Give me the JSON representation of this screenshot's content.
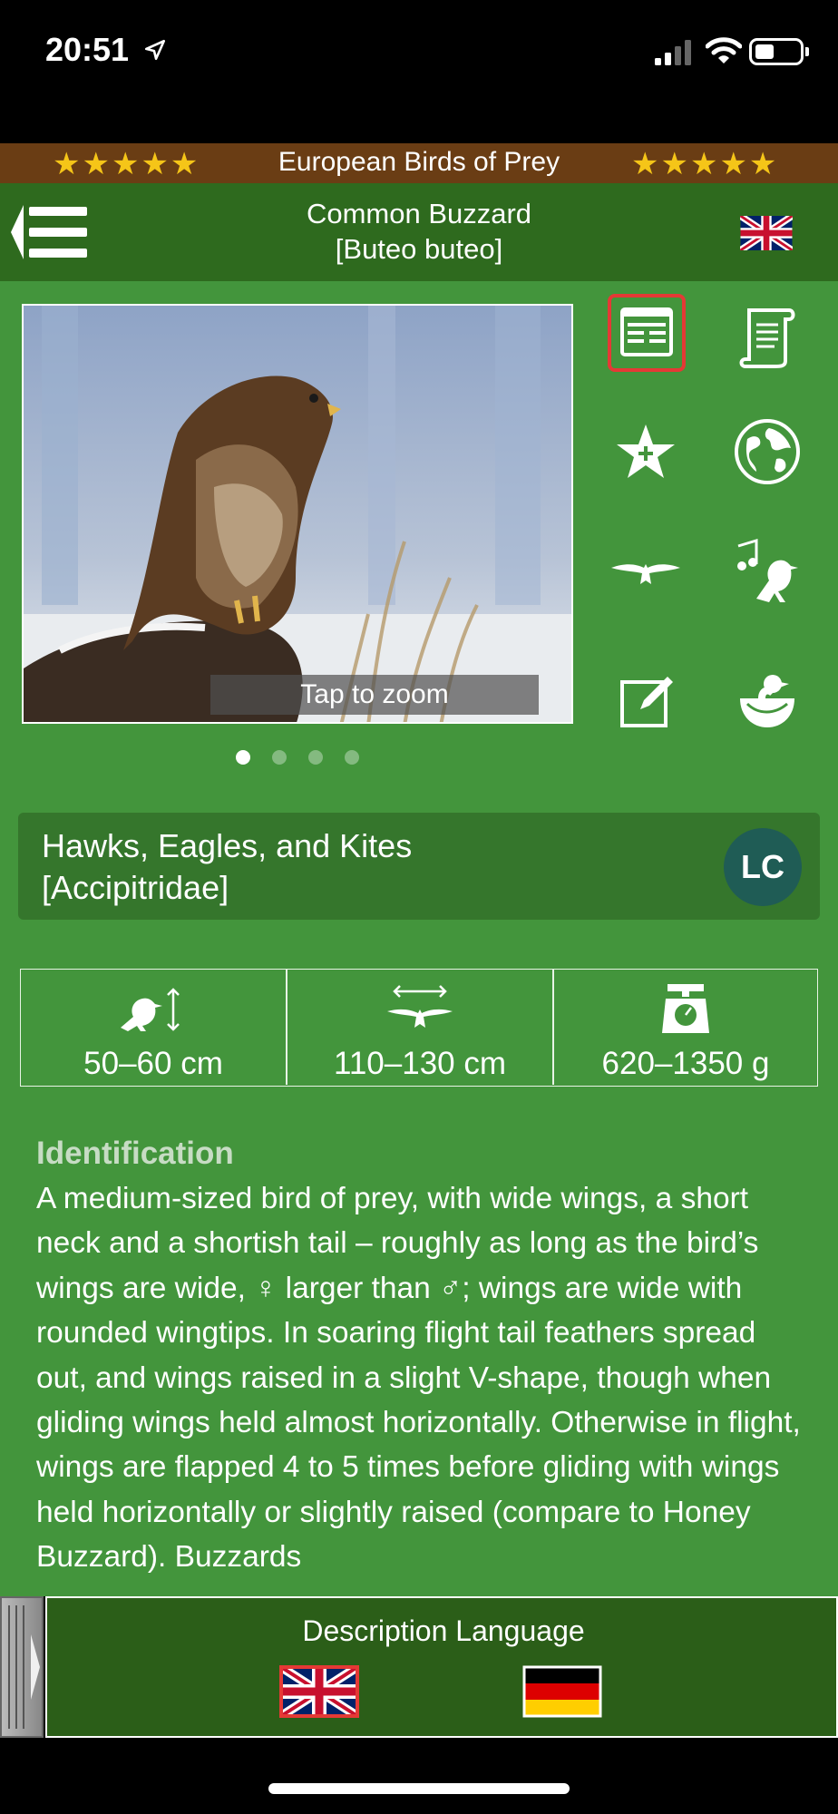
{
  "status": {
    "time": "20:51"
  },
  "banner": {
    "title": "European Birds of Prey",
    "stars_left": "★★★★★",
    "stars_right": "★★★★★"
  },
  "header": {
    "title_line1": "Common Buzzard",
    "title_line2": "[Buteo buteo]"
  },
  "photo": {
    "zoom_label": "Tap to zoom",
    "pager": {
      "count": 4,
      "active": 1
    }
  },
  "icons": [
    "description-icon",
    "scroll-text-icon",
    "star-badge-icon",
    "globe-icon",
    "flight-silhouette-icon",
    "bird-song-icon",
    "notes-edit-icon",
    "nest-egg-icon"
  ],
  "family": {
    "line1": "Hawks, Eagles, and Kites",
    "line2": "[Accipitridae]",
    "status_badge": "LC"
  },
  "measurements": {
    "length": "50–60 cm",
    "wingspan": "110–130 cm",
    "weight": "620–1350 g"
  },
  "identification": {
    "heading": "Identification",
    "text": "A medium-sized bird of prey, with wide wings, a short neck and a shortish tail – roughly as long as the bird’s wings are wide, ♀ larger than ♂; wings are wide with rounded wingtips. In soaring flight tail feathers spread out, and wings raised in a slight V-shape, though when gliding wings held almost horizontally. Otherwise in flight, wings are flapped 4 to 5 times before gliding with wings held horizontally or slightly raised (compare to Honey Buzzard). Buzzards"
  },
  "language_panel": {
    "title": "Description Language",
    "selected": "English",
    "options": [
      "English",
      "German"
    ]
  },
  "colors": {
    "header": "#2e6a1e",
    "content": "#43953c",
    "banner": "#6a3d14",
    "selected_border": "#e53935",
    "badge": "#1f5c55"
  }
}
